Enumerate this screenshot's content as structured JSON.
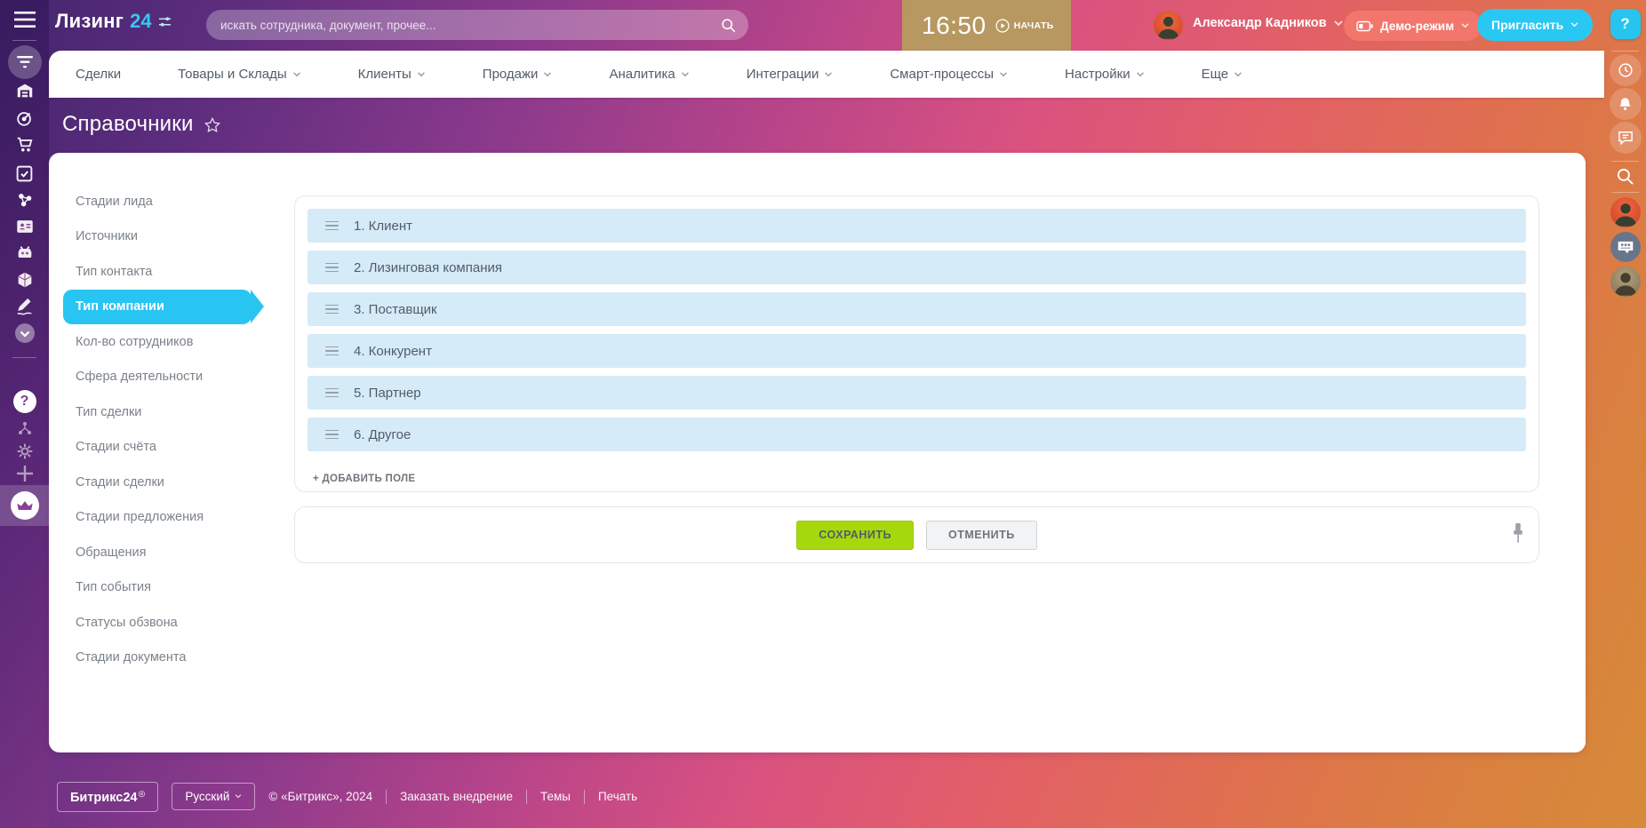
{
  "topbar": {
    "brand": "Лизинг",
    "brand_suffix": "24",
    "search_placeholder": "искать сотрудника, документ, прочее...",
    "time": "16:50",
    "start_label": "НАЧАТЬ",
    "user_name": "Александр Кадников",
    "demo_label": "Демо-режим",
    "invite_label": "Пригласить",
    "help_q": "?"
  },
  "nav": {
    "items": [
      "Сделки",
      "Товары и Склады",
      "Клиенты",
      "Продажи",
      "Аналитика",
      "Интеграции",
      "Смарт-процессы",
      "Настройки",
      "Еще"
    ]
  },
  "page": {
    "title": "Справочники"
  },
  "sidebar_menu": {
    "selected": "Тип компании",
    "items": [
      "Стадии лида",
      "Источники",
      "Тип контакта",
      "Тип компании",
      "Кол-во сотрудников",
      "Сфера деятельности",
      "Тип сделки",
      "Стадии счёта",
      "Стадии сделки",
      "Стадии предложения",
      "Обращения",
      "Тип события",
      "Статусы обзвона",
      "Стадии документа"
    ]
  },
  "list": {
    "rows": [
      "1. Клиент",
      "2. Лизинговая компания",
      "3. Поставщик",
      "4. Конкурент",
      "5. Партнер",
      "6. Другое"
    ],
    "add_label": "+ ДОБАВИТЬ ПОЛЕ"
  },
  "actions": {
    "save": "СОХРАНИТЬ",
    "cancel": "ОТМЕНИТЬ"
  },
  "footer": {
    "brand": "Битрикс24",
    "language": "Русский",
    "copyright": "© «Битрикс», 2024",
    "links": [
      "Заказать внедрение",
      "Темы",
      "Печать"
    ]
  },
  "colors": {
    "accent_cyan": "#29c5f2",
    "invite_cyan": "#29c8f3",
    "demo_salmon": "#f3766c",
    "save_green": "#a6d80e",
    "row_blue": "#d5ebf8",
    "time_gold": "#b69c5f"
  }
}
